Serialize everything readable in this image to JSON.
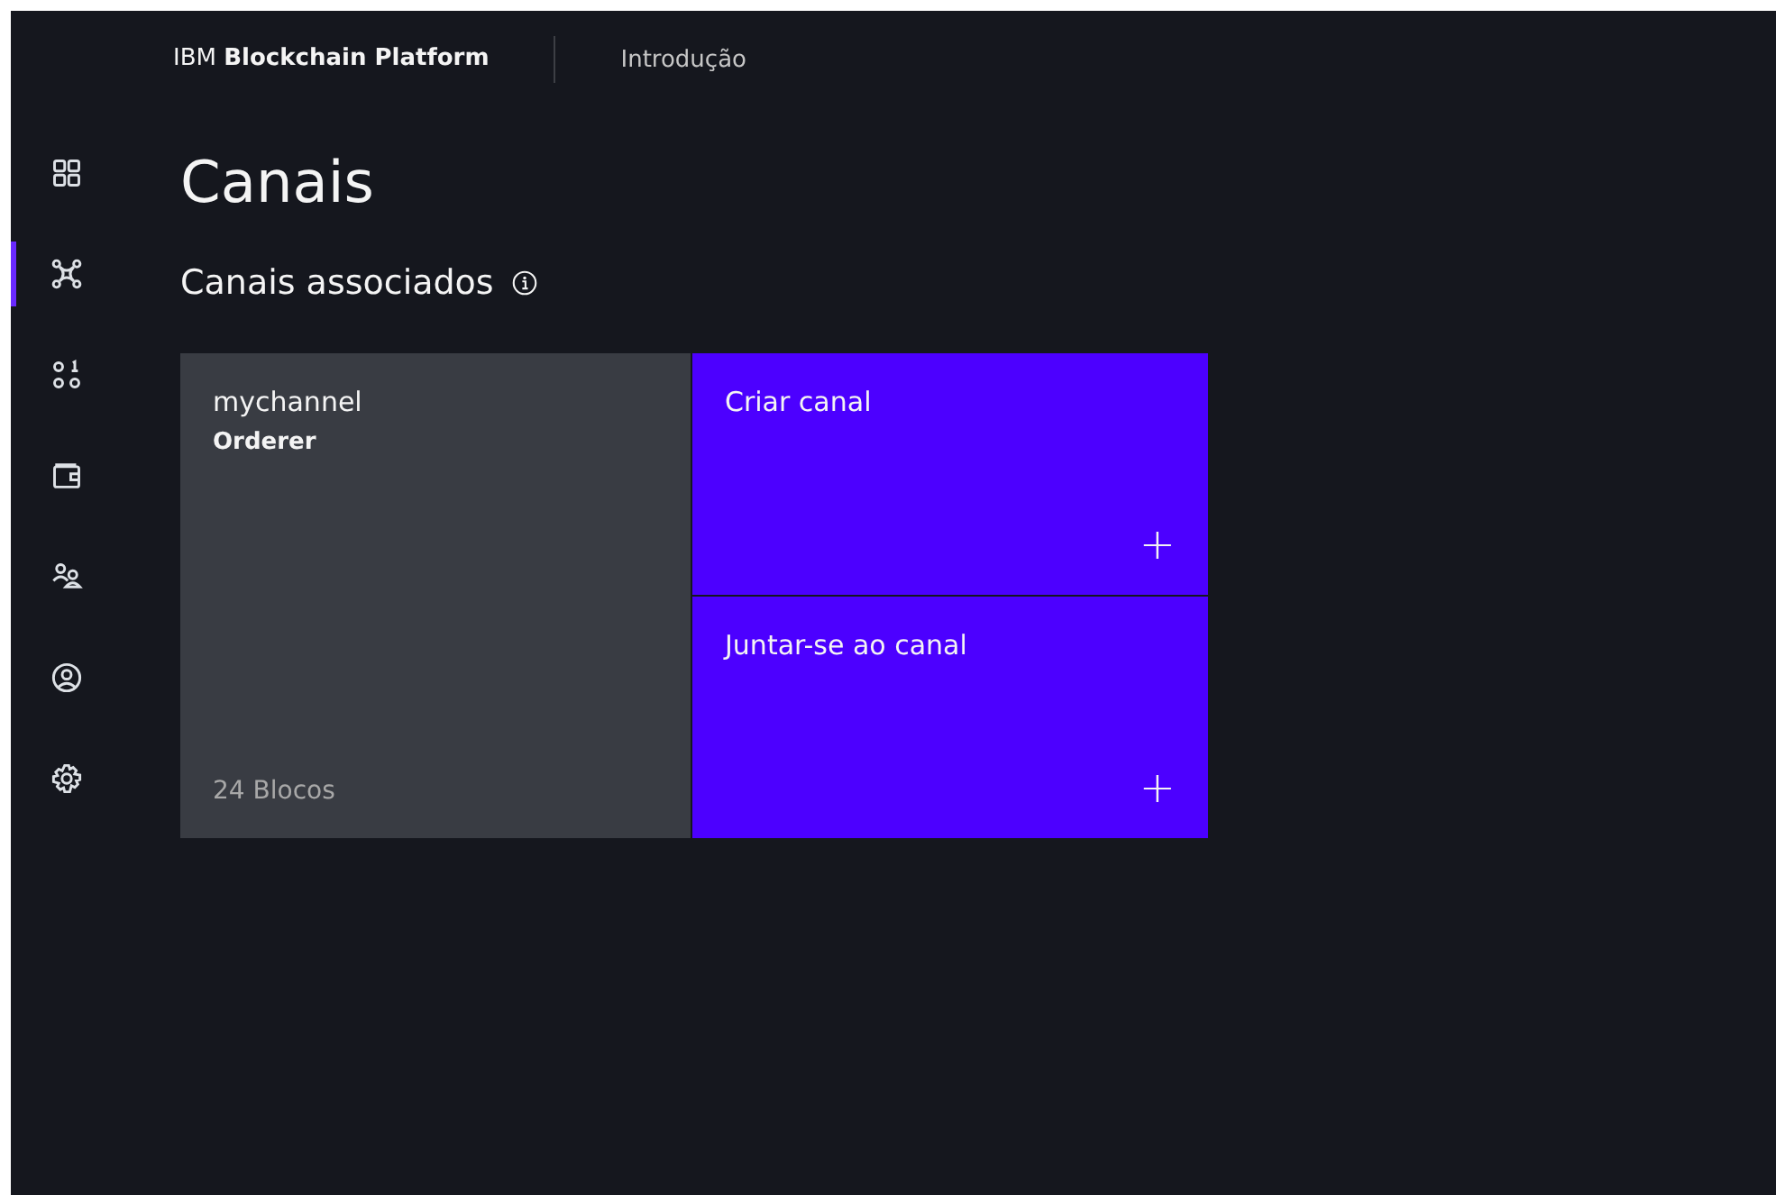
{
  "header": {
    "brand": "IBM **Blockchain Platform**",
    "nav": "Introdução"
  },
  "sidebar": {
    "items": [
      {
        "kind": "grid",
        "selected": false
      },
      {
        "kind": "network",
        "selected": true
      },
      {
        "kind": "binary",
        "selected": false
      },
      {
        "kind": "wallet",
        "selected": false
      },
      {
        "kind": "users",
        "selected": false
      },
      {
        "kind": "user",
        "selected": false
      },
      {
        "kind": "settings",
        "selected": false
      }
    ]
  },
  "page": {
    "title": "Canais",
    "section": "Canais associados"
  },
  "channels": [
    {
      "name": "mychannel",
      "role": "Orderer",
      "blocks": "24 Blocos"
    }
  ],
  "actions": [
    {
      "label": "Criar canal",
      "icon": "+"
    },
    {
      "label": "Juntar-se ao canal",
      "icon": "+"
    }
  ]
}
